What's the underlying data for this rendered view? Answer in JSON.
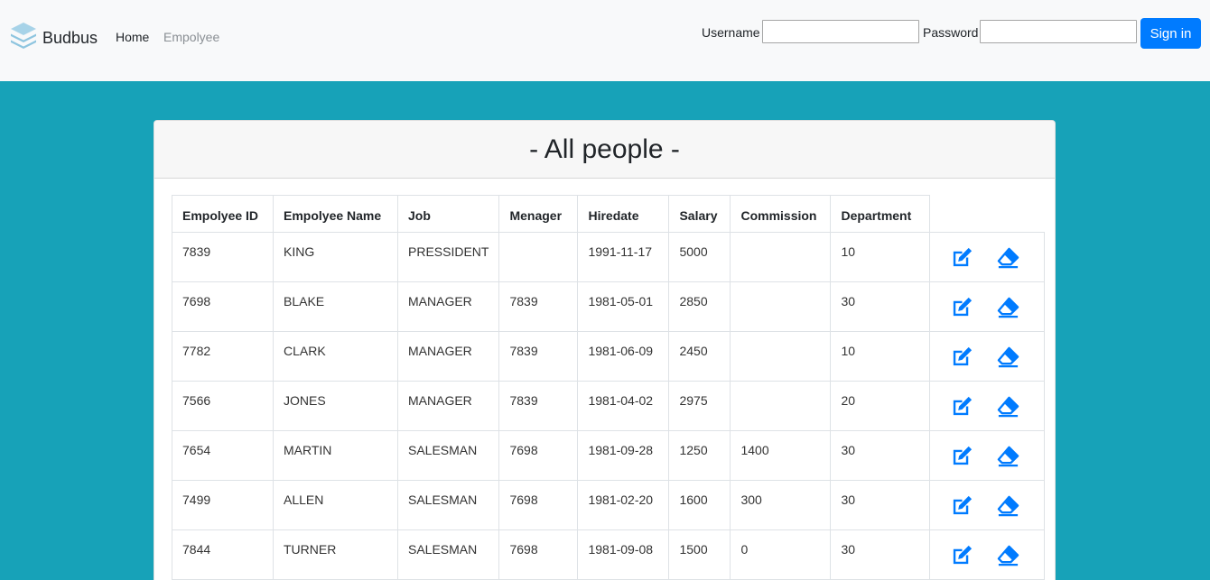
{
  "brand": {
    "name": "Budbus",
    "icon": "layers-icon"
  },
  "nav": {
    "home": "Home",
    "employee": "Empolyee"
  },
  "login": {
    "username_label": "Username",
    "password_label": "Password",
    "username_value": "",
    "password_value": "",
    "signin_label": "Sign in"
  },
  "colors": {
    "page_bg": "#17a2b8",
    "primary": "#007bff",
    "navbar_bg": "#f8f9fa"
  },
  "card": {
    "title": "- All people -"
  },
  "table": {
    "headers": [
      "Empolyee ID",
      "Empolyee Name",
      "Job",
      "Menager",
      "Hiredate",
      "Salary",
      "Commission",
      "Department"
    ],
    "rows": [
      [
        "7839",
        "KING",
        "PRESSIDENT",
        "",
        "1991-11-17",
        "5000",
        "",
        "10"
      ],
      [
        "7698",
        "BLAKE",
        "MANAGER",
        "7839",
        "1981-05-01",
        "2850",
        "",
        "30"
      ],
      [
        "7782",
        "CLARK",
        "MANAGER",
        "7839",
        "1981-06-09",
        "2450",
        "",
        "10"
      ],
      [
        "7566",
        "JONES",
        "MANAGER",
        "7839",
        "1981-04-02",
        "2975",
        "",
        "20"
      ],
      [
        "7654",
        "MARTIN",
        "SALESMAN",
        "7698",
        "1981-09-28",
        "1250",
        "1400",
        "30"
      ],
      [
        "7499",
        "ALLEN",
        "SALESMAN",
        "7698",
        "1981-02-20",
        "1600",
        "300",
        "30"
      ],
      [
        "7844",
        "TURNER",
        "SALESMAN",
        "7698",
        "1981-09-08",
        "1500",
        "0",
        "30"
      ]
    ],
    "row_actions": [
      "edit-icon",
      "eraser-icon"
    ]
  }
}
